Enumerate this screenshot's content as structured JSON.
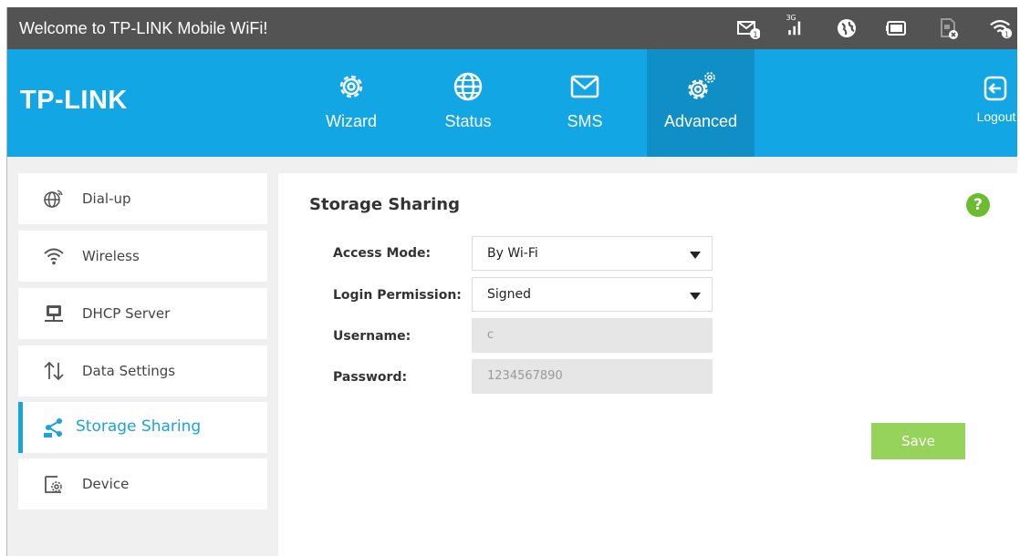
{
  "statusbar": {
    "welcome": "Welcome to TP-LINK Mobile WiFi!",
    "network_type": "3G",
    "sms_count": "1",
    "wifi_clients": "1",
    "icons": [
      "sms-unread-icon",
      "signal-3g-icon",
      "internet-globe-icon",
      "battery-icon",
      "sim-card-icon",
      "wifi-clients-icon"
    ]
  },
  "header": {
    "logo": "TP-LINK",
    "nav": [
      {
        "label": "Wizard",
        "icon": "gear-icon"
      },
      {
        "label": "Status",
        "icon": "globe-icon"
      },
      {
        "label": "SMS",
        "icon": "envelope-icon"
      },
      {
        "label": "Advanced",
        "icon": "gears-icon",
        "active": true
      }
    ],
    "logout": "Logout"
  },
  "sidebar": {
    "items": [
      {
        "label": "Dial-up",
        "icon": "dialup-globe-icon"
      },
      {
        "label": "Wireless",
        "icon": "wifi-icon"
      },
      {
        "label": "DHCP Server",
        "icon": "server-icon"
      },
      {
        "label": "Data Settings",
        "icon": "up-down-arrows-icon"
      },
      {
        "label": "Storage Sharing",
        "icon": "share-icon",
        "active": true
      },
      {
        "label": "Device",
        "icon": "device-settings-icon"
      }
    ]
  },
  "main": {
    "title": "Storage Sharing",
    "help": "?",
    "form": {
      "access_mode": {
        "label": "Access Mode:",
        "value": "By Wi-Fi"
      },
      "login_permission": {
        "label": "Login Permission:",
        "value": "Signed"
      },
      "username": {
        "label": "Username:",
        "value": "c"
      },
      "password": {
        "label": "Password:",
        "value": "1234567890"
      }
    },
    "save_label": "Save"
  },
  "colors": {
    "header_blue": "#12a7e4",
    "active_nav": "#0f8fc6",
    "accent": "#1aa3e0",
    "save_green": "#95d35a",
    "help_green": "#6bbd2f",
    "statusbar": "#535353"
  }
}
